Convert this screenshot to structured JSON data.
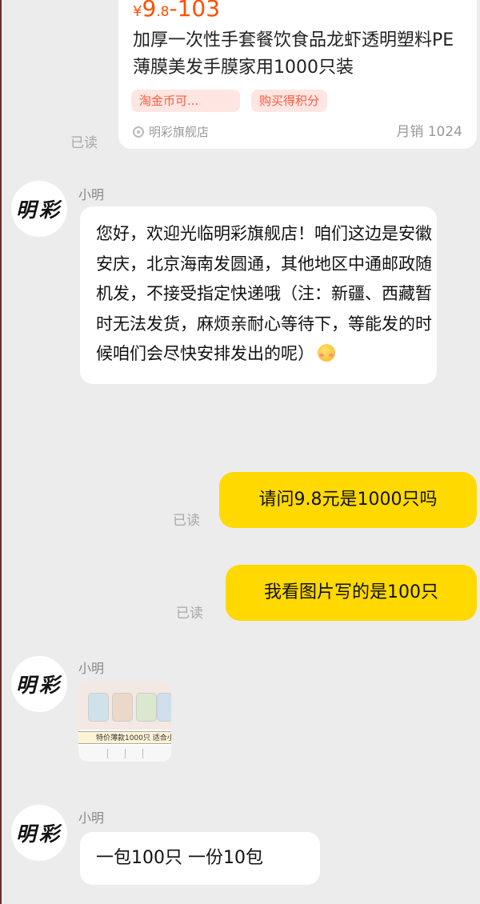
{
  "product_card": {
    "price_currency": "¥",
    "price_int": "9",
    "price_decimal": ".8",
    "price_range": "-103",
    "title": "加厚一次性手套餐饮食品龙虾透明塑料PE薄膜美发手膜家用1000只装",
    "tags": [
      "淘金币可...",
      "购买得积分"
    ],
    "shop_name": "明彩旗舰店",
    "sales": "月销 1024"
  },
  "read_label": "已读",
  "avatar_text": "明彩",
  "messages": {
    "welcome": {
      "sender": "小明",
      "text": "您好，欢迎光临明彩旗舰店！咱们这边是安徽安庆，北京海南发圆通，其他地区中通邮政随机发，不接受指定快递哦（注：新疆、西藏暂时无法发货，麻烦亲耐心等待下，等能发的时候咱们会尽快安排发出的呢）",
      "emoji": "blushing-face"
    },
    "q1": {
      "text": "请问9.8元是1000只吗"
    },
    "q2": {
      "text": "我看图片写的是100只"
    },
    "image": {
      "sender": "小明",
      "thumb_caption": "特价薄款1000只 适合小号"
    },
    "pack": {
      "sender": "小明",
      "text": "一包100只  一份10包"
    }
  },
  "colors": {
    "accent": "#ff5000",
    "my_bubble": "#ffd900",
    "background": "#ececec"
  }
}
